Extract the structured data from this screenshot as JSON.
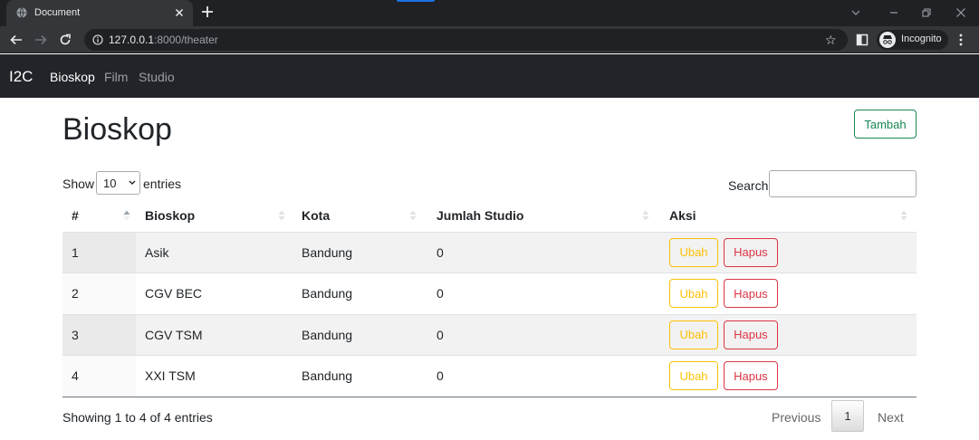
{
  "browser": {
    "tab_title": "Document",
    "url_host": "127.0.0.1",
    "url_path": ":8000/theater",
    "incognito_label": "Incognito"
  },
  "navbar": {
    "brand": "I2C",
    "links": [
      "Bioskop",
      "Film",
      "Studio"
    ],
    "active_link": "Bioskop"
  },
  "page": {
    "title": "Bioskop",
    "add_button": "Tambah"
  },
  "datatable": {
    "show_label": "Show",
    "length_value": "10",
    "entries_label": "entries",
    "search_label": "Search:",
    "search_value": "",
    "columns": [
      "#",
      "Bioskop",
      "Kota",
      "Jumlah Studio",
      "Aksi"
    ],
    "rows": [
      {
        "no": "1",
        "bioskop": "Asik",
        "kota": "Bandung",
        "jumlah_studio": "0"
      },
      {
        "no": "2",
        "bioskop": "CGV BEC",
        "kota": "Bandung",
        "jumlah_studio": "0"
      },
      {
        "no": "3",
        "bioskop": "CGV TSM",
        "kota": "Bandung",
        "jumlah_studio": "0"
      },
      {
        "no": "4",
        "bioskop": "XXI TSM",
        "kota": "Bandung",
        "jumlah_studio": "0"
      }
    ],
    "edit_label": "Ubah",
    "delete_label": "Hapus",
    "info": "Showing 1 to 4 of 4 entries",
    "prev_label": "Previous",
    "current_page": "1",
    "next_label": "Next"
  },
  "colors": {
    "success": "#198754",
    "warning": "#ffc107",
    "danger": "#dc3545",
    "navbar_bg": "#212529"
  }
}
